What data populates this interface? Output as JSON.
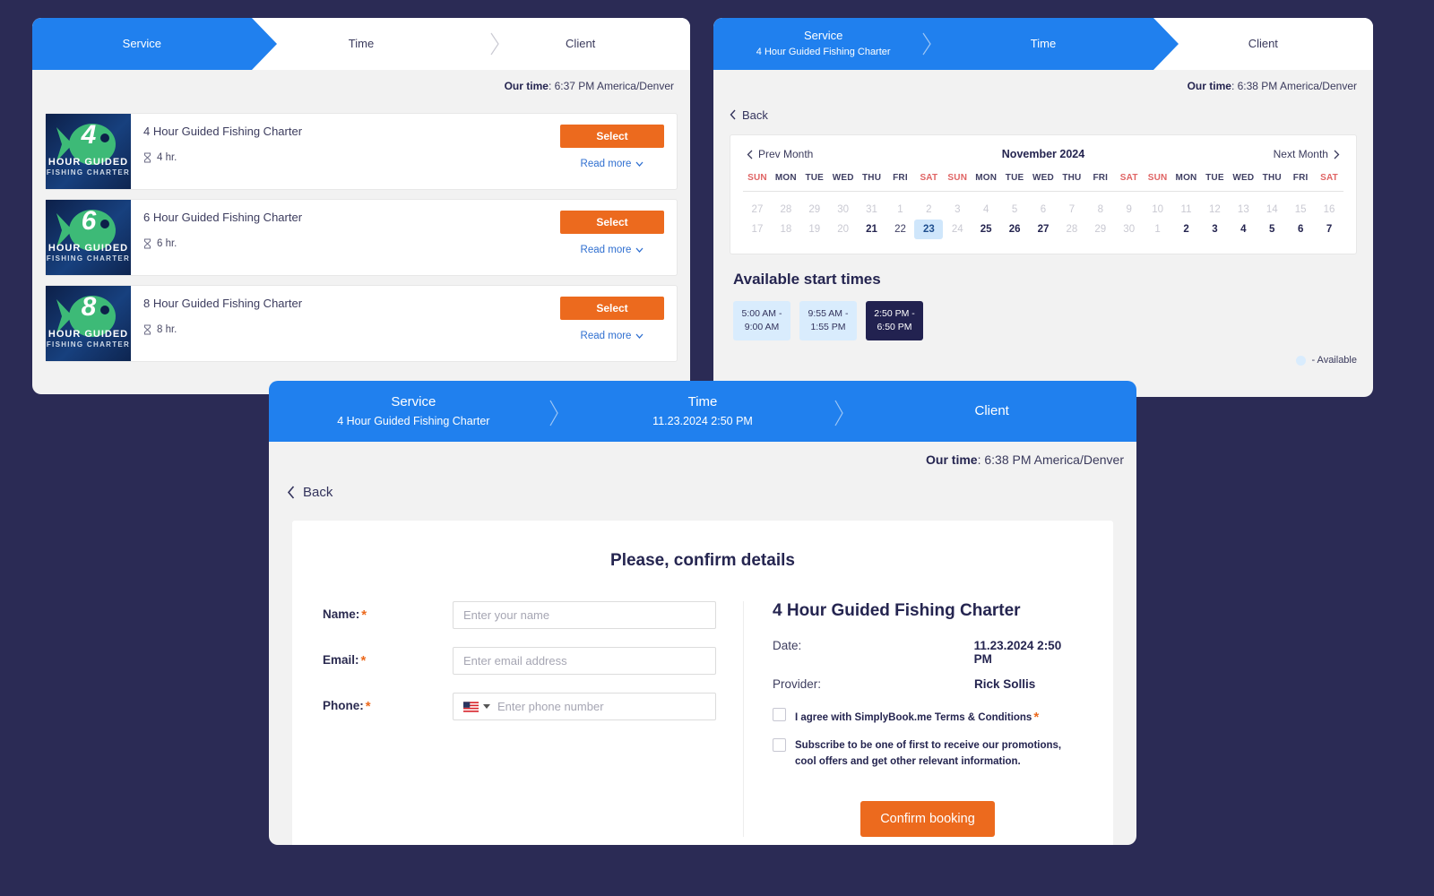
{
  "theme": {
    "background": "#2b2b55",
    "accent_blue": "#2080ee",
    "accent_orange": "#ec6a1e",
    "dark_navy": "#222250",
    "available_blue": "#d9ecfd"
  },
  "panel_service": {
    "tabs": [
      {
        "title": "Service",
        "sub": "",
        "active": true
      },
      {
        "title": "Time",
        "sub": "",
        "active": false
      },
      {
        "title": "Client",
        "sub": "",
        "active": false
      }
    ],
    "our_time_label": "Our time",
    "our_time_value": ": 6:37 PM America/Denver",
    "services": [
      {
        "name": "4 Hour Guided Fishing Charter",
        "duration": "4 hr.",
        "thumb_number": "4",
        "thumb_line1": "HOUR GUIDED",
        "thumb_line2": "FISHING CHARTER",
        "select_label": "Select",
        "read_more_label": "Read more"
      },
      {
        "name": "6 Hour Guided Fishing Charter",
        "duration": "6 hr.",
        "thumb_number": "6",
        "thumb_line1": "HOUR GUIDED",
        "thumb_line2": "FISHING CHARTER",
        "select_label": "Select",
        "read_more_label": "Read more"
      },
      {
        "name": "8 Hour Guided Fishing Charter",
        "duration": "8 hr.",
        "thumb_number": "8",
        "thumb_line1": "HOUR GUIDED",
        "thumb_line2": "FISHING CHARTER",
        "select_label": "Select",
        "read_more_label": "Read more"
      }
    ]
  },
  "panel_time": {
    "tabs": [
      {
        "title": "Service",
        "sub": "4 Hour Guided Fishing Charter",
        "active": true
      },
      {
        "title": "Time",
        "sub": "",
        "active": true
      },
      {
        "title": "Client",
        "sub": "",
        "active": false
      }
    ],
    "our_time_label": "Our time",
    "our_time_value": ": 6:38 PM America/Denver",
    "back_label": "Back",
    "calendar": {
      "prev_label": "Prev Month",
      "next_label": "Next Month",
      "month_label": "November 2024",
      "dow": [
        "SUN",
        "MON",
        "TUE",
        "WED",
        "THU",
        "FRI",
        "SAT",
        "SUN",
        "MON",
        "TUE",
        "WED",
        "THU",
        "FRI",
        "SAT",
        "SUN",
        "MON",
        "TUE",
        "WED",
        "THU",
        "FRI",
        "SAT"
      ],
      "row1": [
        {
          "d": "27",
          "s": "mut"
        },
        {
          "d": "28",
          "s": "mut"
        },
        {
          "d": "29",
          "s": "mut"
        },
        {
          "d": "30",
          "s": "mut"
        },
        {
          "d": "31",
          "s": "mut"
        },
        {
          "d": "1",
          "s": "mut"
        },
        {
          "d": "2",
          "s": "mut"
        },
        {
          "d": "3",
          "s": "mut"
        },
        {
          "d": "4",
          "s": "mut"
        },
        {
          "d": "5",
          "s": "mut"
        },
        {
          "d": "6",
          "s": "mut"
        },
        {
          "d": "7",
          "s": "mut"
        },
        {
          "d": "8",
          "s": "mut"
        },
        {
          "d": "9",
          "s": "mut"
        },
        {
          "d": "10",
          "s": "mut"
        },
        {
          "d": "11",
          "s": "mut"
        },
        {
          "d": "12",
          "s": "mut"
        },
        {
          "d": "13",
          "s": "mut"
        },
        {
          "d": "14",
          "s": "mut"
        },
        {
          "d": "15",
          "s": "mut"
        },
        {
          "d": "16",
          "s": "mut"
        }
      ],
      "row2": [
        {
          "d": "17",
          "s": "mut"
        },
        {
          "d": "18",
          "s": "mut"
        },
        {
          "d": "19",
          "s": "mut"
        },
        {
          "d": "20",
          "s": "mut"
        },
        {
          "d": "21",
          "s": "bold"
        },
        {
          "d": "22",
          "s": "on"
        },
        {
          "d": "23",
          "s": "sel"
        },
        {
          "d": "24",
          "s": "mut"
        },
        {
          "d": "25",
          "s": "bold"
        },
        {
          "d": "26",
          "s": "bold"
        },
        {
          "d": "27",
          "s": "bold"
        },
        {
          "d": "28",
          "s": "mut"
        },
        {
          "d": "29",
          "s": "mut"
        },
        {
          "d": "30",
          "s": "mut"
        },
        {
          "d": "1",
          "s": "mut"
        },
        {
          "d": "2",
          "s": "bold"
        },
        {
          "d": "3",
          "s": "bold"
        },
        {
          "d": "4",
          "s": "bold"
        },
        {
          "d": "5",
          "s": "bold"
        },
        {
          "d": "6",
          "s": "bold"
        },
        {
          "d": "7",
          "s": "bold"
        }
      ]
    },
    "times_heading": "Available start times",
    "slots": [
      {
        "line1": "5:00 AM -",
        "line2": "9:00 AM",
        "selected": false
      },
      {
        "line1": "9:55 AM -",
        "line2": "1:55 PM",
        "selected": false
      },
      {
        "line1": "2:50 PM -",
        "line2": "6:50 PM",
        "selected": true
      }
    ],
    "legend_label": "- Available"
  },
  "panel_client": {
    "tabs": [
      {
        "title": "Service",
        "sub": "4 Hour Guided Fishing Charter",
        "active": true
      },
      {
        "title": "Time",
        "sub": "11.23.2024 2:50 PM",
        "active": true
      },
      {
        "title": "Client",
        "sub": "",
        "active": true
      }
    ],
    "our_time_label": "Our time",
    "our_time_value": ": 6:38 PM America/Denver",
    "back_label": "Back",
    "form_title": "Please, confirm details",
    "fields": {
      "name_label": "Name:",
      "name_placeholder": "Enter your name",
      "name_value": "",
      "email_label": "Email:",
      "email_placeholder": "Enter email address",
      "email_value": "",
      "phone_label": "Phone:",
      "phone_placeholder": "Enter phone number",
      "phone_value": ""
    },
    "summary": {
      "service_title": "4 Hour Guided Fishing Charter",
      "date_key": "Date:",
      "date_value": "11.23.2024 2:50 PM",
      "provider_key": "Provider:",
      "provider_value": "Rick Sollis"
    },
    "consents": [
      {
        "text": "I agree with SimplyBook.me Terms & Conditions",
        "required": true,
        "checked": false
      },
      {
        "text": "Subscribe to be one of first to receive our promotions, cool offers and get other relevant information.",
        "required": false,
        "checked": false
      }
    ],
    "confirm_label": "Confirm booking"
  }
}
